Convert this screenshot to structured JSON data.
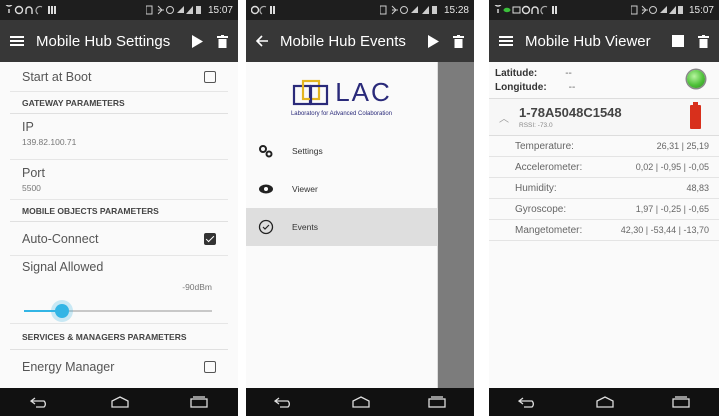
{
  "colors": {
    "appbar": "#373737",
    "accent": "#33b5e5",
    "led": "#4fc13a",
    "battery": "#d8301c"
  },
  "settings_screen": {
    "status_time": "15:07",
    "title": "Mobile Hub Settings",
    "start_at_boot": {
      "label": "Start at Boot",
      "checked": false
    },
    "section_gateway": "GATEWAY PARAMETERS",
    "ip": {
      "label": "IP",
      "value": "139.82.100.71"
    },
    "port": {
      "label": "Port",
      "value": "5500"
    },
    "section_mobile_objects": "MOBILE OBJECTS PARAMETERS",
    "auto_connect": {
      "label": "Auto-Connect",
      "checked": true
    },
    "signal_allowed": {
      "label": "Signal Allowed",
      "value": "-90dBm",
      "level": 0.2
    },
    "section_services": "SERVICES & MANAGERS PARAMETERS",
    "energy_manager": {
      "label": "Energy Manager",
      "checked": false
    }
  },
  "events_screen": {
    "status_time": "15:28",
    "title": "Mobile Hub Events",
    "logo_text": "LAC",
    "logo_subtitle": "Laboratory for Advanced Colaboration",
    "drawer_items": [
      {
        "label": "Settings",
        "icon": "gears-icon"
      },
      {
        "label": "Viewer",
        "icon": "eye-icon"
      },
      {
        "label": "Events",
        "icon": "events-icon",
        "active": true
      }
    ]
  },
  "viewer_screen": {
    "status_time": "15:07",
    "title": "Mobile Hub Viewer",
    "latitude_label": "Latitude:",
    "latitude_value": "--",
    "longitude_label": "Longitude:",
    "longitude_value": "--",
    "device_id": "1-78A5048C1548",
    "rssi": "RSSI: -73.0",
    "sensors": [
      {
        "label": "Temperature:",
        "value": "26,31 | 25,19"
      },
      {
        "label": "Accelerometer:",
        "value": "0,02 | -0,95 | -0,05"
      },
      {
        "label": "Humidity:",
        "value": "48,83"
      },
      {
        "label": "Gyroscope:",
        "value": "1,97 | -0,25 | -0,65"
      },
      {
        "label": "Mangetometer:",
        "value": "42,30 | -53,44 | -13,70"
      }
    ]
  }
}
